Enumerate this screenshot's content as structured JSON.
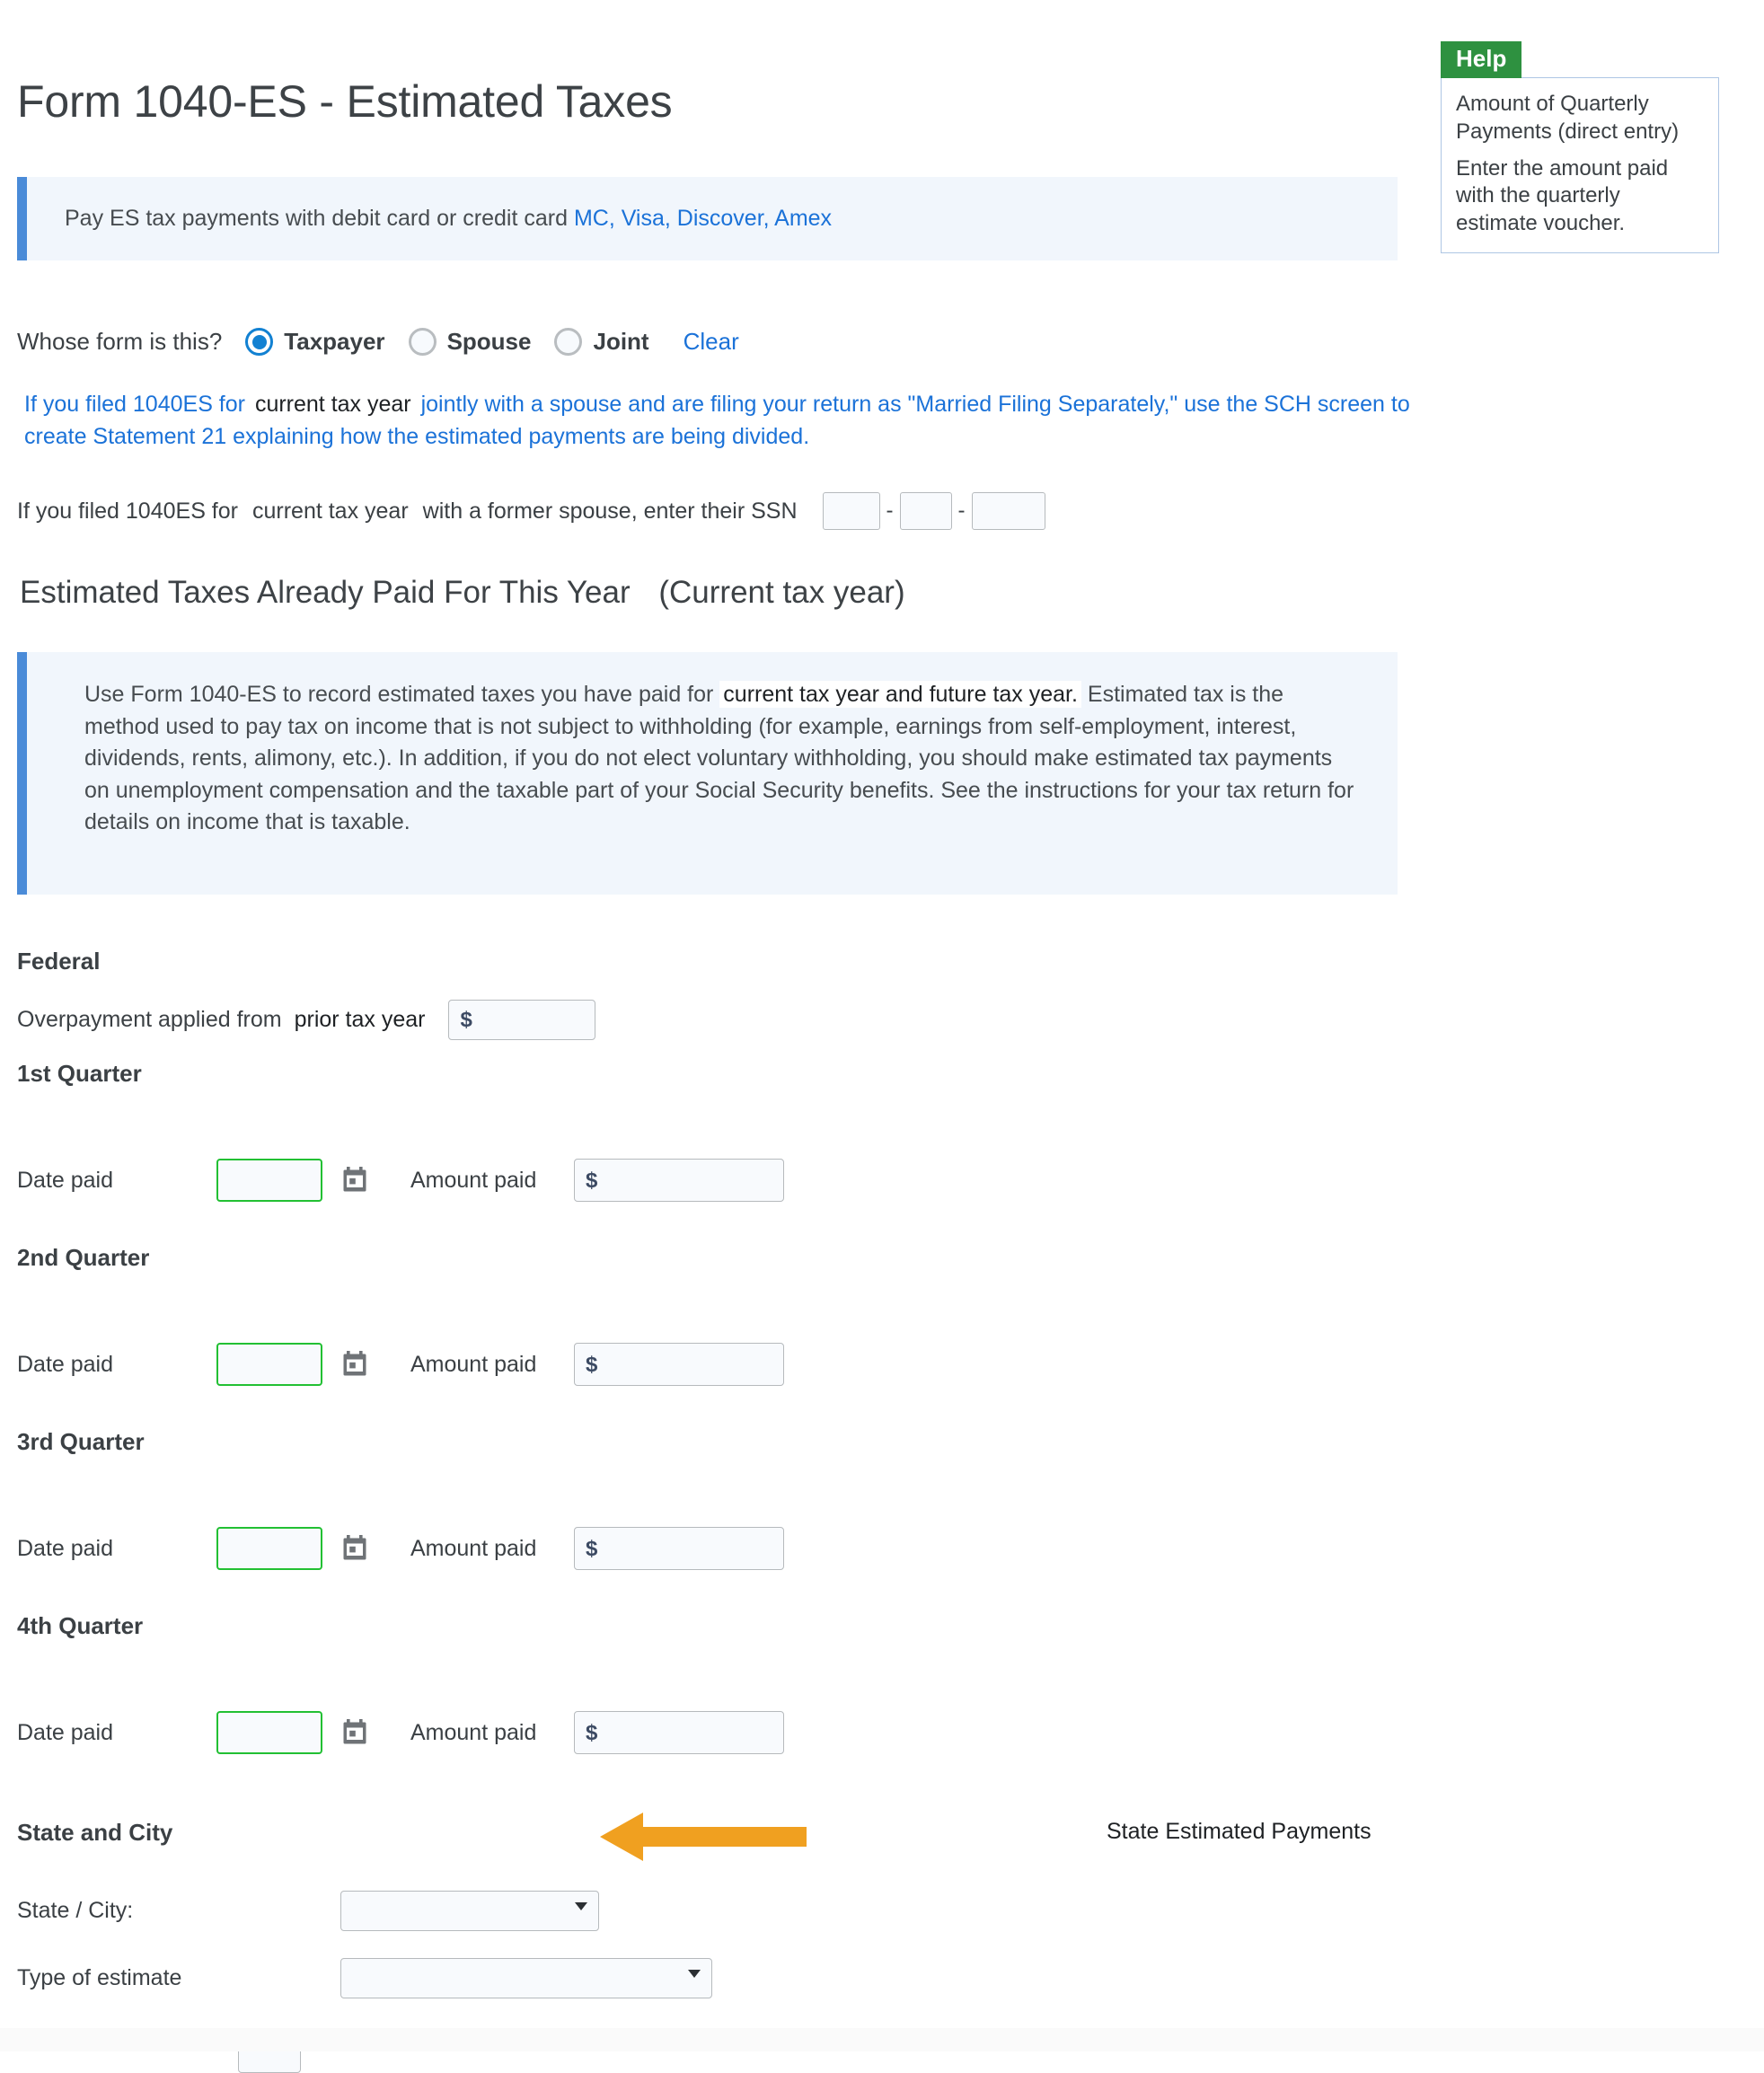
{
  "help": {
    "badge_label": "Help",
    "lines": [
      "Amount of Quarterly Payments (direct entry)",
      "Enter the amount paid with the quarterly estimate voucher."
    ]
  },
  "page_title": "Form 1040-ES - Estimated Taxes",
  "pay_banner": {
    "text": "Pay ES tax payments with debit card or credit card",
    "link_text": "MC, Visa, Discover, Amex"
  },
  "whose_form": {
    "question": "Whose form is this?",
    "options": [
      {
        "label": "Taxpayer",
        "selected": true
      },
      {
        "label": "Spouse",
        "selected": false
      },
      {
        "label": "Joint",
        "selected": false
      }
    ],
    "clear_label": "Clear"
  },
  "blue_note": {
    "part1": "If you filed 1040ES for",
    "chip": "current tax year",
    "part2": "jointly with a spouse and are filing your return as \"Married Filing Separately,\" use the SCH screen to create Statement 21 explaining how the estimated payments are being divided."
  },
  "ssn_row": {
    "label_start": "If you filed 1040ES for",
    "chip": "current tax year",
    "label_end": "with a former spouse, enter their SSN",
    "separator": "-",
    "values": [
      "",
      "",
      ""
    ]
  },
  "section_heading": {
    "main": "Estimated Taxes Already Paid For This Year",
    "sub": "(Current tax year)"
  },
  "use_banner": {
    "part1": "Use Form 1040-ES to record estimated taxes you have paid for",
    "chip": "current tax year and future tax year.",
    "part2": "Estimated tax is the method used to pay tax on income that is not subject to withholding (for example, earnings from self-employment, interest, dividends, rents, alimony, etc.). In addition, if you do not elect voluntary withholding, you should make estimated tax payments on unemployment compensation and the taxable part of your Social Security benefits. See the instructions for your tax return for details on income that is taxable."
  },
  "federal": {
    "title": "Federal",
    "overpayment": {
      "label": "Overpayment applied from",
      "chip": "prior tax year",
      "currency_symbol": "$",
      "value": ""
    },
    "quarters": [
      {
        "title": "1st Quarter",
        "date_label": "Date paid",
        "date_value": "",
        "amount_label": "Amount paid",
        "amount_value": "",
        "currency_symbol": "$",
        "calendar_icon": "calendar-icon"
      },
      {
        "title": "2nd Quarter",
        "date_label": "Date paid",
        "date_value": "",
        "amount_label": "Amount paid",
        "amount_value": "",
        "currency_symbol": "$",
        "calendar_icon": "calendar-icon"
      },
      {
        "title": "3rd Quarter",
        "date_label": "Date paid",
        "date_value": "",
        "amount_label": "Amount paid",
        "amount_value": "",
        "currency_symbol": "$",
        "calendar_icon": "calendar-icon"
      },
      {
        "title": "4th Quarter",
        "date_label": "Date paid",
        "date_value": "",
        "amount_label": "Amount paid",
        "amount_value": "",
        "currency_symbol": "$",
        "calendar_icon": "calendar-icon"
      }
    ]
  },
  "state_city": {
    "title": "State and City",
    "annotation_text": "State Estimated Payments",
    "annotation_icon": "left-arrow-icon",
    "state_city_label": "State / City:",
    "state_city_value": "",
    "type_estimate_label": "Type of estimate",
    "type_estimate_value": ""
  },
  "colors": {
    "accent_blue": "#4a8bd8",
    "banner_bg": "#f1f6fc",
    "link_blue": "#1b72d8",
    "help_green": "#2e9140",
    "date_border_green": "#22c033",
    "annotation_orange": "#f0a020",
    "radio_selected": "#1281d2"
  }
}
